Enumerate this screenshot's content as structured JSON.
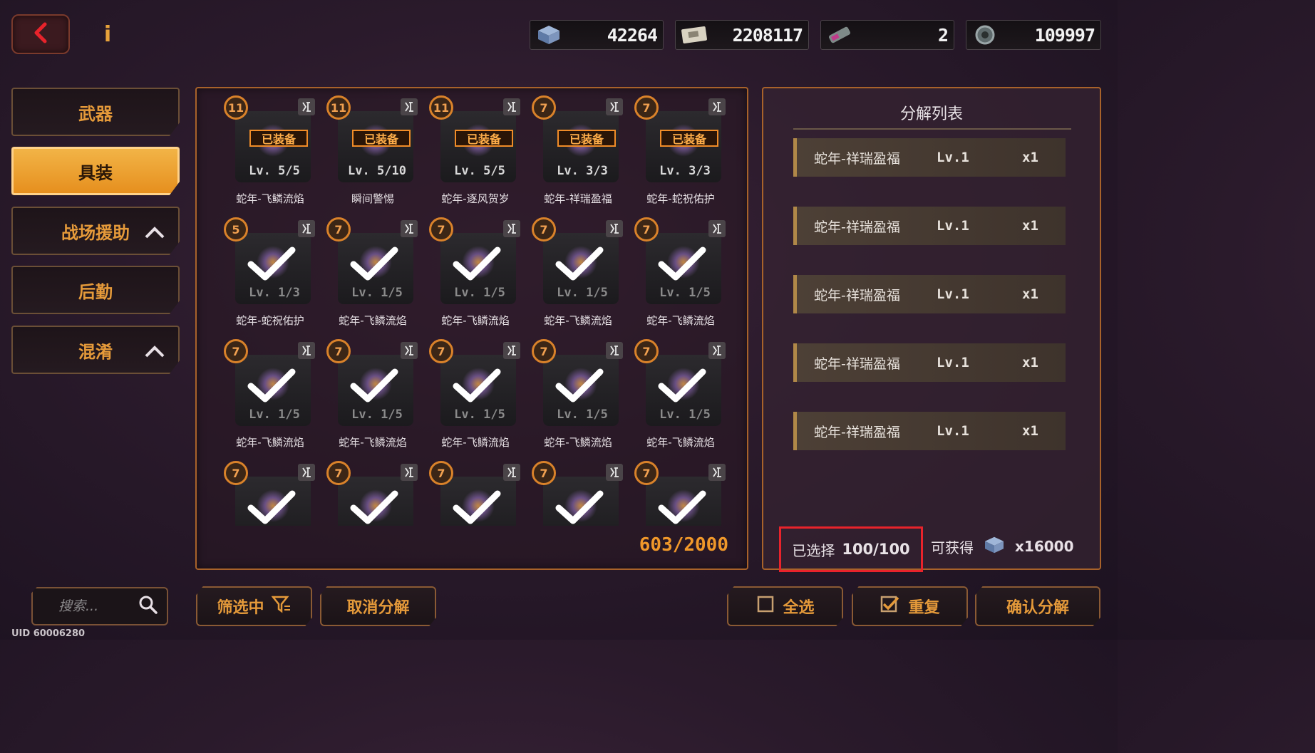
{
  "header": {
    "back_icon": "chevron-left-icon",
    "info_label": "i",
    "currencies": [
      {
        "icon": "ore-crate-icon",
        "value": "42264"
      },
      {
        "icon": "ticket-icon",
        "value": "2208117"
      },
      {
        "icon": "chip-icon",
        "value": "2"
      },
      {
        "icon": "gear-coin-icon",
        "value": "109997"
      }
    ]
  },
  "sidebar": {
    "tabs": [
      {
        "label": "武器",
        "active": false,
        "expandable": false
      },
      {
        "label": "具装",
        "active": true,
        "expandable": false
      },
      {
        "label": "战场援助",
        "active": false,
        "expandable": true
      },
      {
        "label": "后勤",
        "active": false,
        "expandable": false
      },
      {
        "label": "混淆",
        "active": false,
        "expandable": true
      }
    ]
  },
  "grid": {
    "equipped_tag": "已装备",
    "count": "603/2000",
    "items": [
      {
        "badge": "11",
        "level": "Lv. 5/5",
        "name": "蛇年-飞鳞流焰",
        "equipped": true,
        "selected": false
      },
      {
        "badge": "11",
        "level": "Lv. 5/10",
        "name": "瞬间警惕",
        "equipped": true,
        "selected": false
      },
      {
        "badge": "11",
        "level": "Lv. 5/5",
        "name": "蛇年-逐风贺岁",
        "equipped": true,
        "selected": false
      },
      {
        "badge": "7",
        "level": "Lv. 3/3",
        "name": "蛇年-祥瑞盈福",
        "equipped": true,
        "selected": false
      },
      {
        "badge": "7",
        "level": "Lv. 3/3",
        "name": "蛇年-蛇祝佑护",
        "equipped": true,
        "selected": false
      },
      {
        "badge": "5",
        "level": "Lv. 1/3",
        "name": "蛇年-蛇祝佑护",
        "equipped": false,
        "selected": true
      },
      {
        "badge": "7",
        "level": "Lv. 1/5",
        "name": "蛇年-飞鳞流焰",
        "equipped": false,
        "selected": true
      },
      {
        "badge": "7",
        "level": "Lv. 1/5",
        "name": "蛇年-飞鳞流焰",
        "equipped": false,
        "selected": true
      },
      {
        "badge": "7",
        "level": "Lv. 1/5",
        "name": "蛇年-飞鳞流焰",
        "equipped": false,
        "selected": true
      },
      {
        "badge": "7",
        "level": "Lv. 1/5",
        "name": "蛇年-飞鳞流焰",
        "equipped": false,
        "selected": true
      },
      {
        "badge": "7",
        "level": "Lv. 1/5",
        "name": "蛇年-飞鳞流焰",
        "equipped": false,
        "selected": true
      },
      {
        "badge": "7",
        "level": "Lv. 1/5",
        "name": "蛇年-飞鳞流焰",
        "equipped": false,
        "selected": true
      },
      {
        "badge": "7",
        "level": "Lv. 1/5",
        "name": "蛇年-飞鳞流焰",
        "equipped": false,
        "selected": true
      },
      {
        "badge": "7",
        "level": "Lv. 1/5",
        "name": "蛇年-飞鳞流焰",
        "equipped": false,
        "selected": true
      },
      {
        "badge": "7",
        "level": "Lv. 1/5",
        "name": "蛇年-飞鳞流焰",
        "equipped": false,
        "selected": true
      },
      {
        "badge": "7",
        "level": "",
        "name": "",
        "equipped": false,
        "selected": true
      },
      {
        "badge": "7",
        "level": "",
        "name": "",
        "equipped": false,
        "selected": true
      },
      {
        "badge": "7",
        "level": "",
        "name": "",
        "equipped": false,
        "selected": true
      },
      {
        "badge": "7",
        "level": "",
        "name": "",
        "equipped": false,
        "selected": true
      },
      {
        "badge": "7",
        "level": "",
        "name": "",
        "equipped": false,
        "selected": true
      }
    ]
  },
  "decompose": {
    "title": "分解列表",
    "rows": [
      {
        "name": "蛇年-祥瑞盈福",
        "level": "Lv.1",
        "qty": "x1"
      },
      {
        "name": "蛇年-祥瑞盈福",
        "level": "Lv.1",
        "qty": "x1"
      },
      {
        "name": "蛇年-祥瑞盈福",
        "level": "Lv.1",
        "qty": "x1"
      },
      {
        "name": "蛇年-祥瑞盈福",
        "level": "Lv.1",
        "qty": "x1"
      },
      {
        "name": "蛇年-祥瑞盈福",
        "level": "Lv.1",
        "qty": "x1"
      }
    ],
    "selected_label": "已选择",
    "selected_value": "100/100",
    "obtain_label": "可获得",
    "obtain_icon": "ore-crate-icon",
    "obtain_amount": "x16000"
  },
  "footer": {
    "search_placeholder": "搜索...",
    "filter_label": "筛选中",
    "cancel_label": "取消分解",
    "select_all_label": "全选",
    "reset_label": "重复",
    "confirm_label": "确认分解",
    "uid": "UID 60006280"
  },
  "colors": {
    "accent": "#e59a3a",
    "highlight_border": "#e8232b"
  }
}
